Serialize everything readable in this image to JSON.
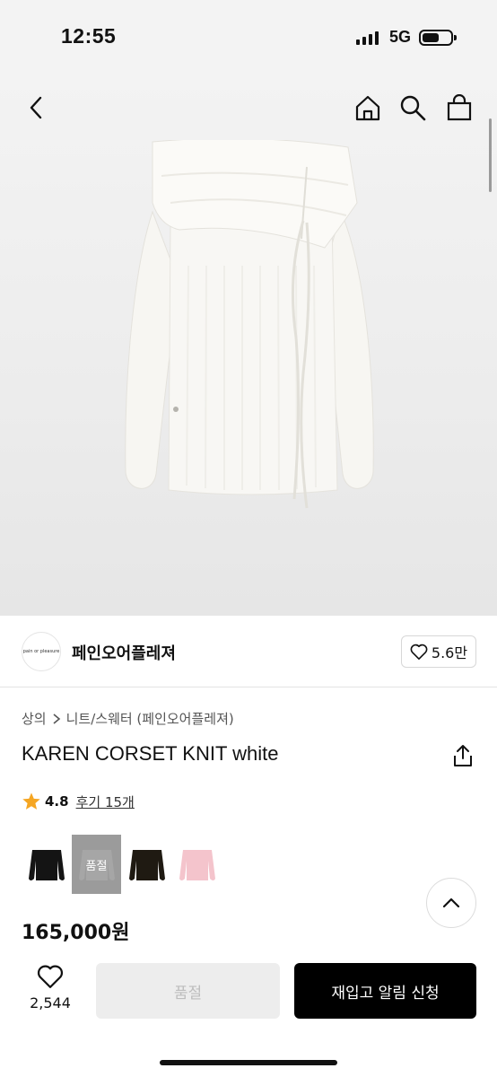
{
  "status_bar": {
    "time": "12:55",
    "network": "5G"
  },
  "nav": {
    "back_icon": "chevron-left-icon",
    "home_icon": "home-icon",
    "search_icon": "search-icon",
    "cart_icon": "shopping-bag-icon"
  },
  "brand": {
    "logo_text": "pain or pleasure",
    "name": "페인오어플레져",
    "follow_count": "5.6만"
  },
  "breadcrumb": [
    "상의",
    "니트/스웨터 (페인오어플레져)"
  ],
  "product": {
    "title": "KAREN CORSET KNIT white",
    "rating": "4.8",
    "reviews_label": "후기 15개",
    "price": "165,000원"
  },
  "options": [
    {
      "color": "black",
      "sold_out": false
    },
    {
      "color": "white",
      "sold_out": true,
      "badge": "품절"
    },
    {
      "color": "brown",
      "sold_out": false
    },
    {
      "color": "pink",
      "sold_out": false
    }
  ],
  "bottom_bar": {
    "wish_count": "2,544",
    "soldout_label": "품절",
    "restock_label": "재입고 알림 신청"
  },
  "colors": {
    "accent_star": "#f5a623",
    "primary_button": "#000000",
    "disabled_button": "#ededed"
  }
}
